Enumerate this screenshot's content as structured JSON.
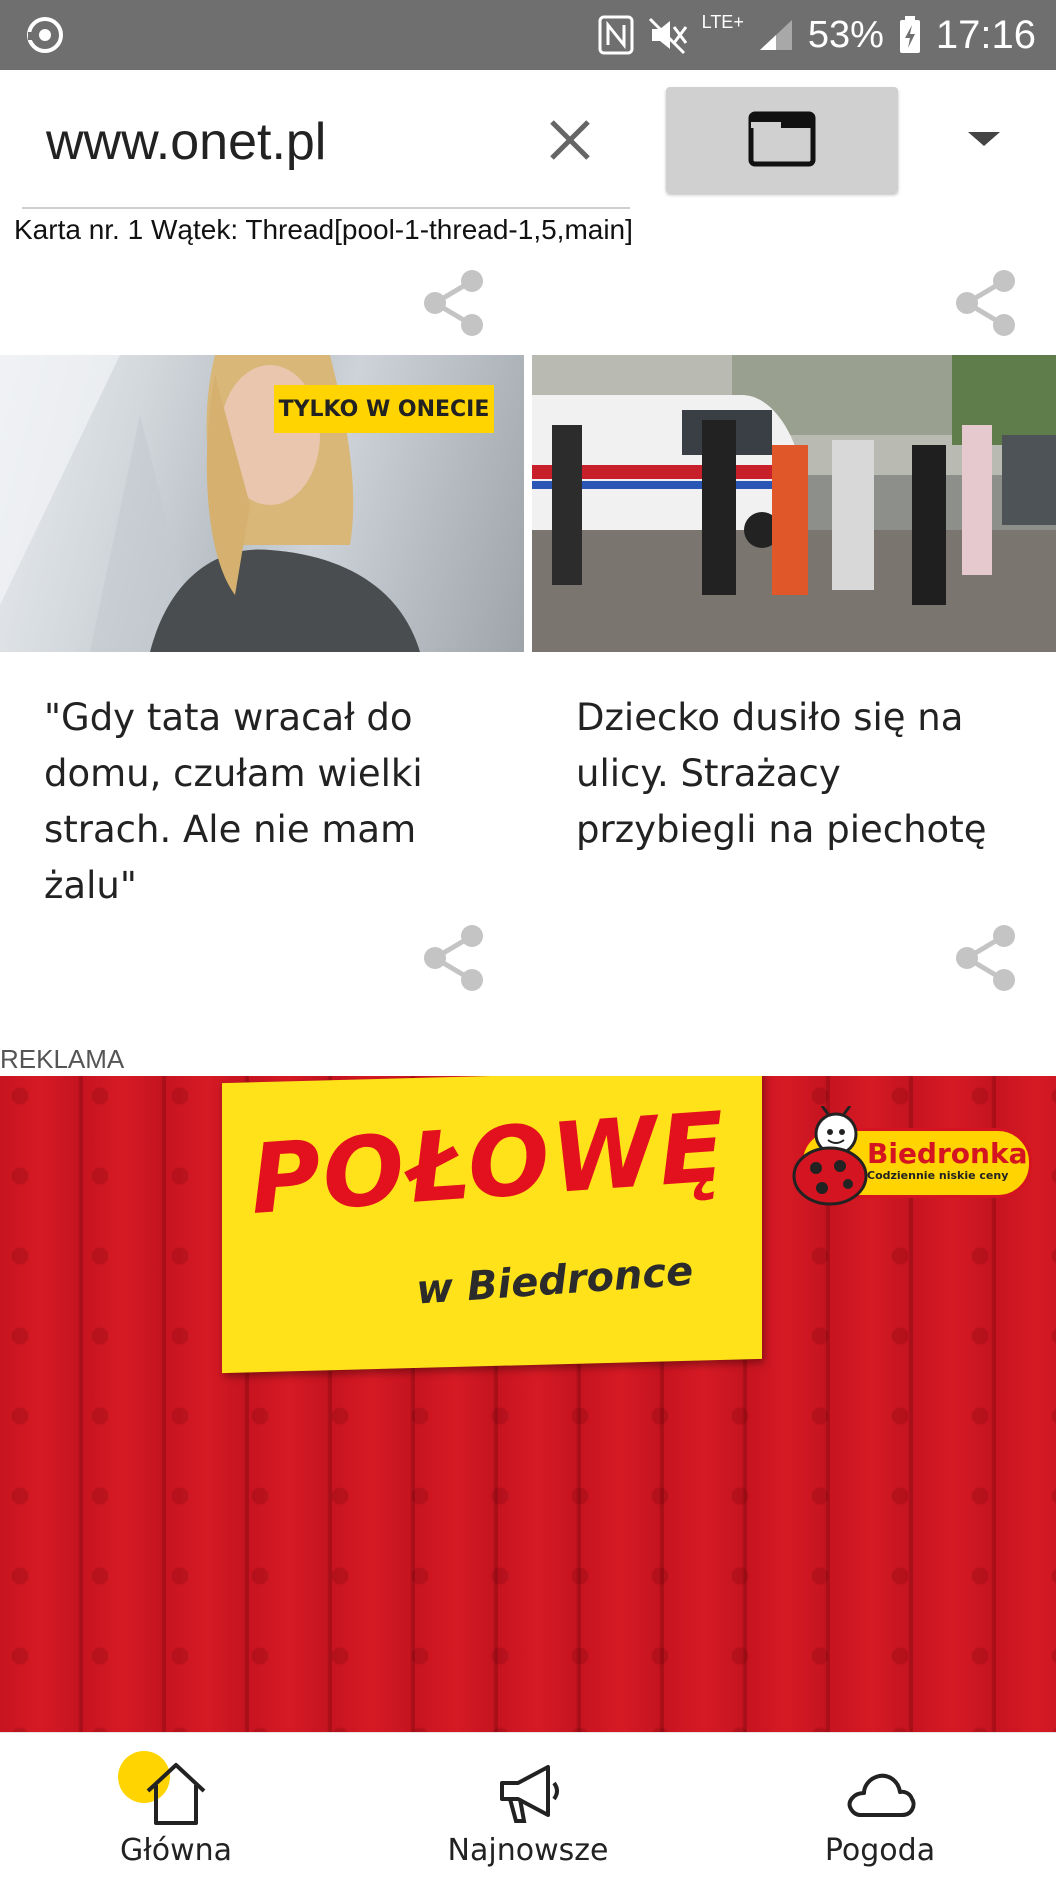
{
  "status_bar": {
    "battery_percent": "53%",
    "time": "17:16",
    "network": "LTE+"
  },
  "address_bar": {
    "url": "www.onet.pl"
  },
  "debug_line": "Karta nr. 1 Wątek: Thread[pool-1-thread-1,5,main]",
  "articles": [
    {
      "badge": "TYLKO W ONECIE",
      "title": "\"Gdy tata wracał do domu, czułam wielki strach. Ale nie mam żalu\""
    },
    {
      "title": "Dziecko dusiło się na ulicy. Strażacy przybiegli na piechotę"
    }
  ],
  "ad": {
    "label": "REKLAMA",
    "headline": "POŁOWĘ",
    "subline": "w Biedronce",
    "brand": "Biedronka",
    "tagline": "Codziennie niskie ceny"
  },
  "bottom_nav": {
    "items": [
      {
        "label": "Główna",
        "icon": "home-icon"
      },
      {
        "label": "Najnowsze",
        "icon": "megaphone-icon"
      },
      {
        "label": "Pogoda",
        "icon": "cloud-icon"
      }
    ]
  }
}
